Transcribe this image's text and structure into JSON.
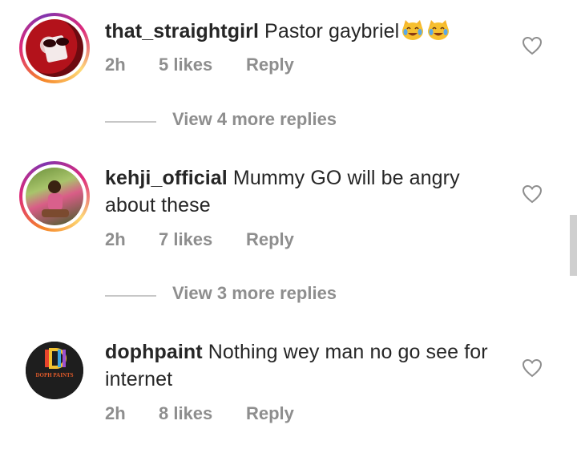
{
  "comments": [
    {
      "username": "that_straightgirl",
      "text": "Pastor gaybriel",
      "emojis": [
        "cat-tears-of-joy",
        "cat-tears-of-joy"
      ],
      "time": "2h",
      "likes": "5 likes",
      "reply": "Reply",
      "view_more": "View 4 more replies"
    },
    {
      "username": "kehji_official",
      "text": "Mummy GO will be angry about these",
      "time": "2h",
      "likes": "7 likes",
      "reply": "Reply",
      "view_more": "View 3 more replies"
    },
    {
      "username": "dophpaint",
      "text": "Nothing wey man no go see for internet",
      "avatar_text": "DOPH PAINTS",
      "time": "2h",
      "likes": "8 likes",
      "reply": "Reply"
    }
  ],
  "colors": {
    "text": "#262626",
    "muted": "#8e8e8e",
    "divider": "#c7c7c7"
  },
  "icons": {
    "like": "heart-outline-icon"
  }
}
